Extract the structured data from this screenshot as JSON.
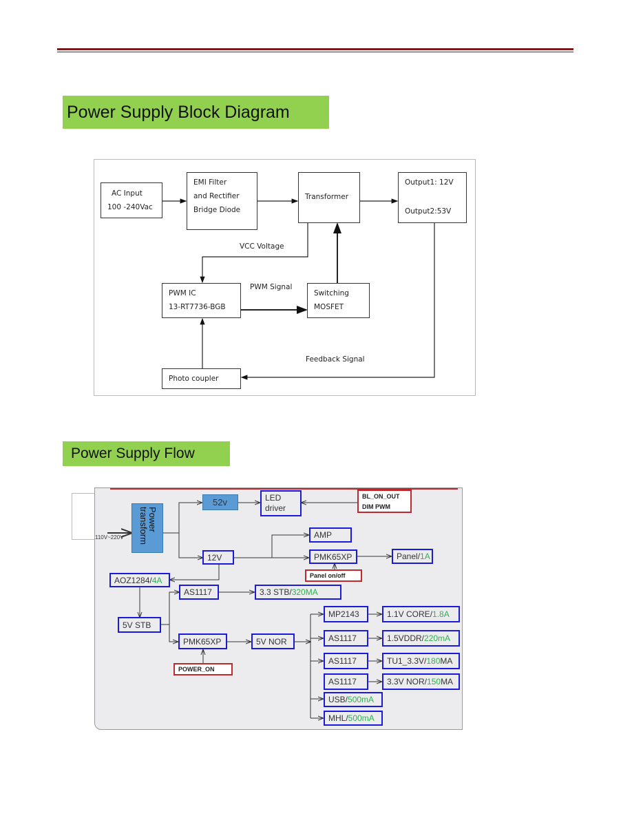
{
  "section1": {
    "title": "Power  Supply Block Diagram",
    "blocks": {
      "ac": [
        "AC    Input",
        "100 -240Vac"
      ],
      "emi": [
        "EMI Filter",
        "and      Rectifier",
        "Bridge     Diode"
      ],
      "transformer": "Transformer",
      "output": [
        "Output1: 12V",
        "Output2:53V"
      ],
      "pwm": [
        "PWM IC",
        "13-RT7736-BGB"
      ],
      "mosfet": [
        "Switching",
        "MOSFET"
      ],
      "photo": "Photo     coupler"
    },
    "labels": {
      "vcc": "VCC Voltage",
      "pwm_signal": "PWM Signal",
      "feedback": "Feedback Signal"
    }
  },
  "section2": {
    "title": "Power Supply Flow",
    "input": "110V~220V",
    "transform": "Power transform",
    "v52": "52v",
    "led": [
      "LED",
      "driver"
    ],
    "bl": [
      "BL_ON_OUT",
      "DIM  PWM"
    ],
    "amp": "AMP",
    "v12": "12V",
    "pmk1": "PMK65XP",
    "panel": {
      "main": "Panel/",
      "green": "1A"
    },
    "panel_onoff": "Panel  on/off",
    "aoz": {
      "main": "AOZ1284/",
      "green": "4A"
    },
    "as1": "AS1117",
    "stb33": {
      "main": "3.3 STB/",
      "green": "320MA"
    },
    "stb5": "5V  STB",
    "pmk2": "PMK65XP",
    "nor5": "5V NOR",
    "power_on": "POWER_ON",
    "rails": [
      {
        "ic": "MP2143",
        "main": "1.1V CORE/",
        "green": "1.8A",
        "tail": ""
      },
      {
        "ic": "AS1117",
        "main": "1.5VDDR/",
        "green": "220mA",
        "tail": ""
      },
      {
        "ic": "AS1117",
        "main": "TU1_3.3V/",
        "green": "180",
        "tail": "MA"
      },
      {
        "ic": "AS1117",
        "main": "3.3V NOR/",
        "green": "150",
        "tail": "MA"
      }
    ],
    "usb": {
      "main": "USB/",
      "green": "500mA"
    },
    "mhl": {
      "main": "MHL/",
      "green": "500mA"
    }
  },
  "colors": {
    "title_bg": "#92d050",
    "rule": "#7b1c1c",
    "box_blue": "#1a1adc",
    "box_red": "#c0282d",
    "current_green": "#2fb04c",
    "transform_fill": "#5b9bd5"
  }
}
